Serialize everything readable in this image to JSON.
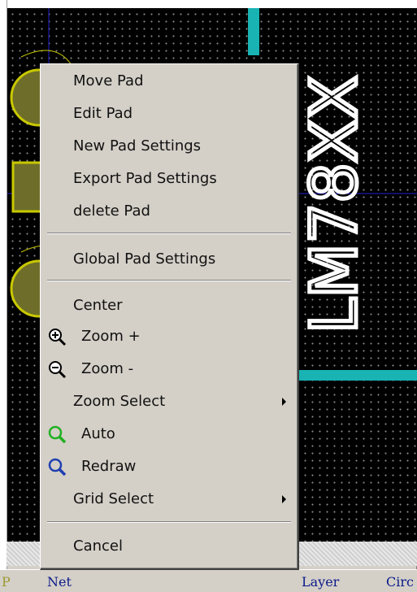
{
  "canvas": {
    "component_label": "LM78XX"
  },
  "context_menu": {
    "items": [
      {
        "label": "Move Pad"
      },
      {
        "label": "Edit Pad"
      },
      {
        "label": "New Pad Settings"
      },
      {
        "label": "Export Pad Settings"
      },
      {
        "label": "delete Pad"
      },
      {
        "label": "Global Pad Settings"
      },
      {
        "label": "Center"
      },
      {
        "label": "Zoom +",
        "icon": "zoom-in-icon"
      },
      {
        "label": "Zoom -",
        "icon": "zoom-out-icon"
      },
      {
        "label": "Zoom Select",
        "submenu": true
      },
      {
        "label": "Auto",
        "icon": "zoom-auto-icon"
      },
      {
        "label": "Redraw",
        "icon": "redraw-icon"
      },
      {
        "label": "Grid Select",
        "submenu": true
      },
      {
        "label": "Cancel"
      }
    ]
  },
  "status_bar": {
    "col1": "P",
    "col2": "Net",
    "col3": "Layer",
    "col4": "Circ"
  },
  "colors": {
    "board_bg": "#000000",
    "trace": "#19b3b3",
    "pad_ring": "#c8c800",
    "pad_fill": "#6e6e2a",
    "silk": "#ffffff"
  }
}
